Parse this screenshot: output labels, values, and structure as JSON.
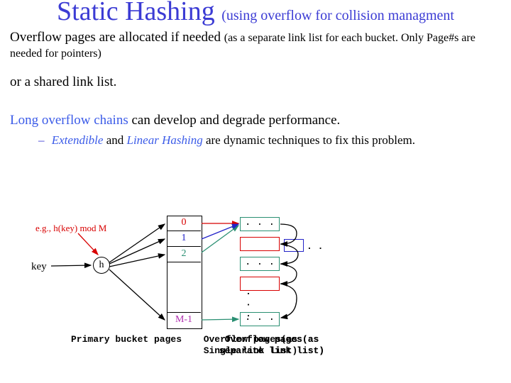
{
  "title": {
    "main": "Static Hashing",
    "sub": "(using overflow for collision managment"
  },
  "body": {
    "p1a": "Overflow pages are allocated if needed ",
    "p1b": "(as a separate link list for each bucket.  Only Page#s are needed for pointers)",
    "p2": "or a shared link list.",
    "p3a": "Long overflow chains",
    "p3b": " can develop and degrade performance.",
    "bullet_pre": "Extendible",
    "bullet_mid": " and ",
    "bullet_post": "Linear Hashing",
    "bullet_tail": " are dynamic techniques to fix this problem."
  },
  "diagram": {
    "example": "e.g., h(key) mod M",
    "key": "key",
    "h": "h",
    "slots": {
      "s0": "0",
      "s1": "1",
      "s2": "2",
      "last": "M-1"
    },
    "dots3": ". . .",
    "dots2": ". .",
    "vdots": ". . .",
    "caption_primary": "Primary bucket pages",
    "caption_ov1": "Overflow pages(as Single link list)",
    "caption_ov2": "Overflow pages(as separate link list)"
  }
}
